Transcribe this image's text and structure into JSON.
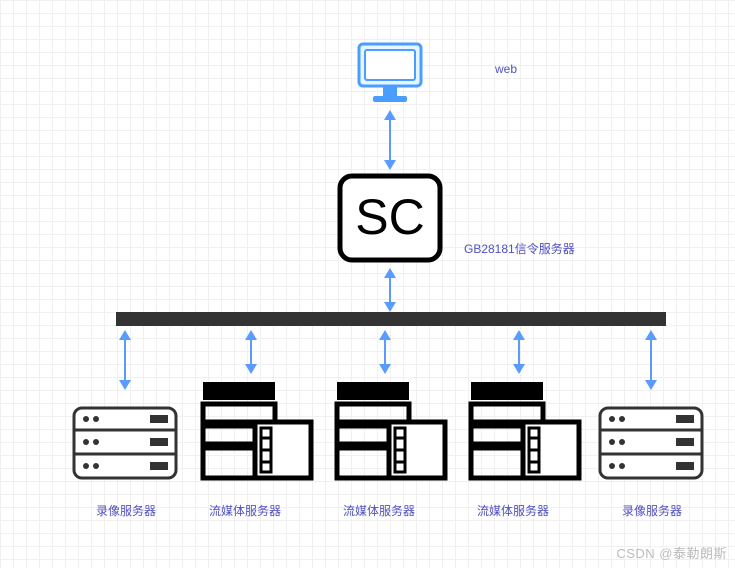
{
  "labels": {
    "web": "web",
    "signaling": "GB28181信令服务器",
    "sc": "SC",
    "recording1": "录像服务器",
    "media1": "流媒体服务器",
    "media2": "流媒体服务器",
    "media3": "流媒体服务器",
    "recording2": "录像服务器"
  },
  "watermark": "CSDN @泰勒朗斯",
  "chart_data": {
    "type": "diagram",
    "title": "",
    "nodes": [
      {
        "id": "web",
        "label": "web",
        "icon": "monitor"
      },
      {
        "id": "sc",
        "label": "GB28181信令服务器",
        "text": "SC",
        "icon": "box"
      },
      {
        "id": "bus",
        "label": "",
        "icon": "bus"
      },
      {
        "id": "rec1",
        "label": "录像服务器",
        "icon": "server"
      },
      {
        "id": "media1",
        "label": "流媒体服务器",
        "icon": "media-server"
      },
      {
        "id": "media2",
        "label": "流媒体服务器",
        "icon": "media-server"
      },
      {
        "id": "media3",
        "label": "流媒体服务器",
        "icon": "media-server"
      },
      {
        "id": "rec2",
        "label": "录像服务器",
        "icon": "server"
      }
    ],
    "edges": [
      {
        "from": "web",
        "to": "sc",
        "bidirectional": true
      },
      {
        "from": "sc",
        "to": "bus",
        "bidirectional": true
      },
      {
        "from": "bus",
        "to": "rec1",
        "bidirectional": true
      },
      {
        "from": "bus",
        "to": "media1",
        "bidirectional": true
      },
      {
        "from": "bus",
        "to": "media2",
        "bidirectional": true
      },
      {
        "from": "bus",
        "to": "media3",
        "bidirectional": true
      },
      {
        "from": "bus",
        "to": "rec2",
        "bidirectional": true
      }
    ]
  }
}
